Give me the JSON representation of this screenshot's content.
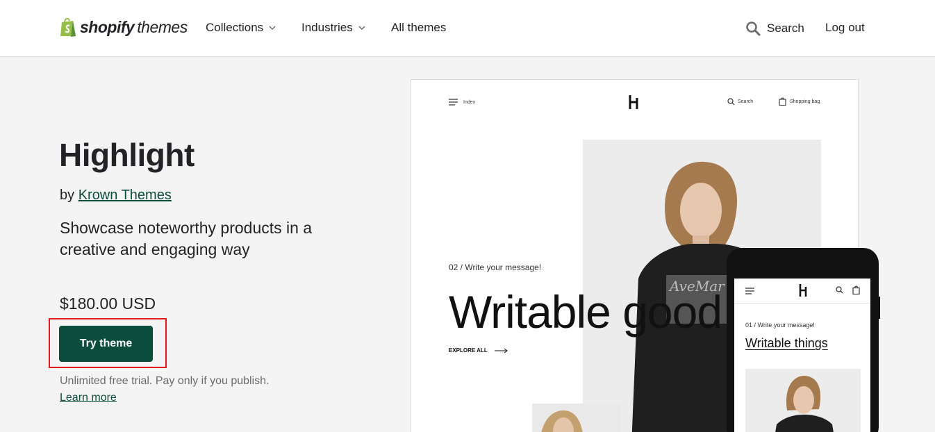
{
  "header": {
    "logo_bold": "shopify",
    "logo_light": "themes",
    "nav": [
      {
        "label": "Collections"
      },
      {
        "label": "Industries"
      },
      {
        "label": "All themes"
      }
    ],
    "search_label": "Search",
    "logout_label": "Log out"
  },
  "theme": {
    "name": "Highlight",
    "by_prefix": "by",
    "author": "Krown Themes",
    "description": "Showcase noteworthy products in a creative and engaging way",
    "price": "$180.00 USD",
    "try_label": "Try theme",
    "trial_note": "Unlimited free trial. Pay only if you publish.",
    "learn_more": "Learn more"
  },
  "preview": {
    "menu_label": "Index",
    "search_label": "Search",
    "bag_label": "Shopping bag",
    "kicker": "02 / Write your message!",
    "headline": "Writable good",
    "explore": "EXPLORE ALL",
    "phone": {
      "kicker": "01 / Write your message!",
      "title": "Writable things"
    }
  },
  "colors": {
    "brand_green": "#0a4d3c",
    "highlight_red": "#e01b1b",
    "shopify_green": "#95bf47"
  }
}
